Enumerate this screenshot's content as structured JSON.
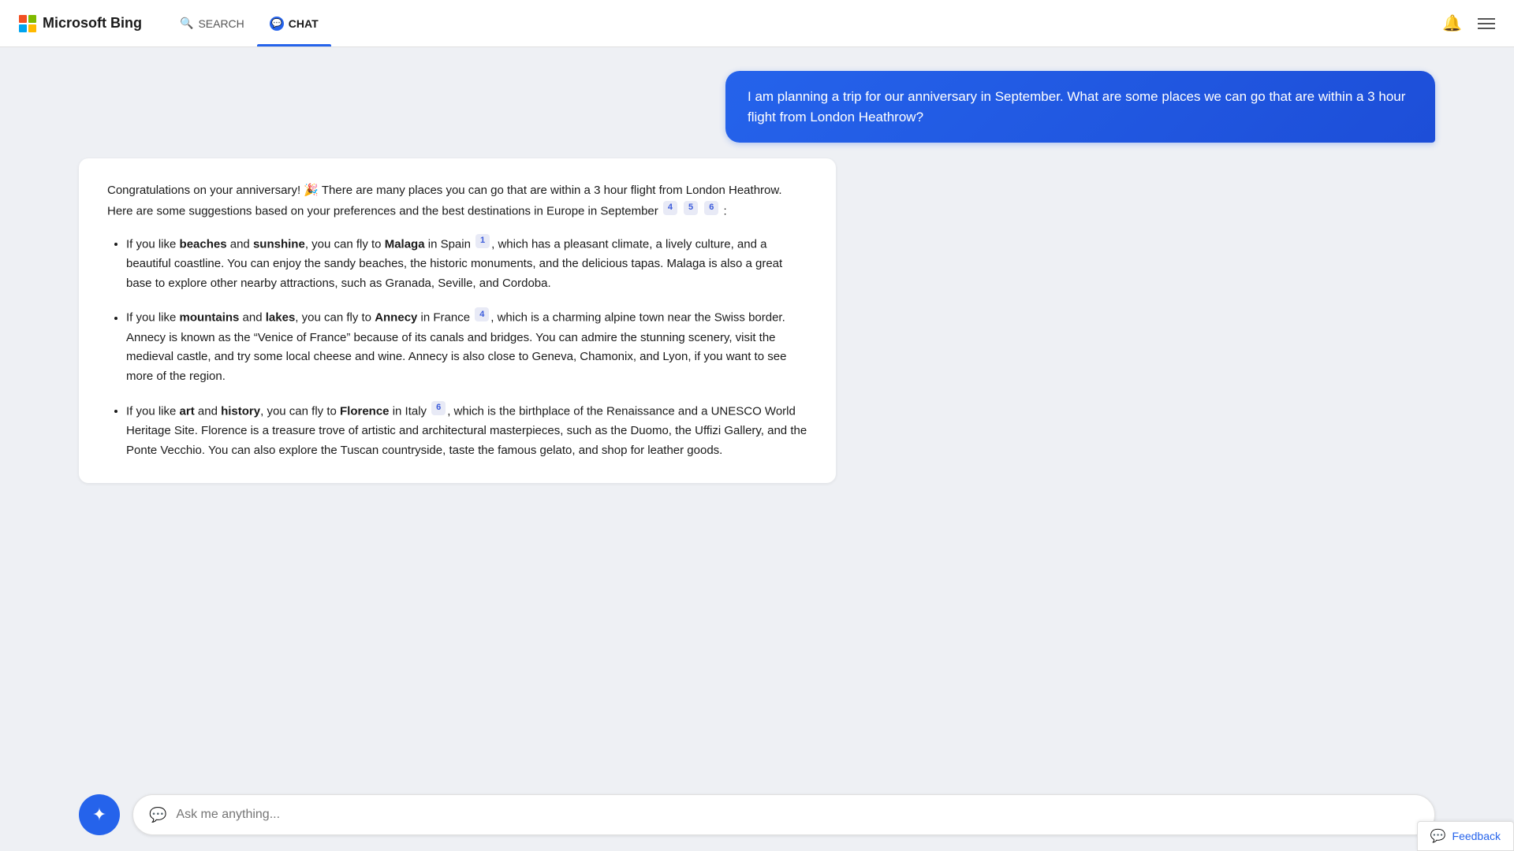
{
  "header": {
    "logo_text": "Microsoft Bing",
    "nav_search": "SEARCH",
    "nav_chat": "CHAT"
  },
  "user_message": "I am planning a trip for our anniversary in September. What are some places we can go that are within a 3 hour flight from London Heathrow?",
  "ai_response": {
    "intro": "Congratulations on your anniversary! 🎉 There are many places you can go that are within a 3 hour flight from London Heathrow. Here are some suggestions based on your preferences and the best destinations in Europe in September",
    "citations_intro": [
      "4",
      "5",
      "6"
    ],
    "items": [
      {
        "text_before": "If you like ",
        "bold1": "beaches",
        "text_mid1": " and ",
        "bold2": "sunshine",
        "text_mid2": ", you can fly to ",
        "bold3": "Malaga",
        "text_mid3": " in Spain",
        "citation": "1",
        "text_after": ", which has a pleasant climate, a lively culture, and a beautiful coastline. You can enjoy the sandy beaches, the historic monuments, and the delicious tapas. Malaga is also a great base to explore other nearby attractions, such as Granada, Seville, and Cordoba."
      },
      {
        "text_before": "If you like ",
        "bold1": "mountains",
        "text_mid1": " and ",
        "bold2": "lakes",
        "text_mid2": ", you can fly to ",
        "bold3": "Annecy",
        "text_mid3": " in France",
        "citation": "4",
        "text_after": ", which is a charming alpine town near the Swiss border. Annecy is known as the “Venice of France” because of its canals and bridges. You can admire the stunning scenery, visit the medieval castle, and try some local cheese and wine. Annecy is also close to Geneva, Chamonix, and Lyon, if you want to see more of the region."
      },
      {
        "text_before": "If you like ",
        "bold1": "art",
        "text_mid1": " and ",
        "bold2": "history",
        "text_mid2": ", you can fly to ",
        "bold3": "Florence",
        "text_mid3": " in Italy",
        "citation": "6",
        "text_after": ", which is the birthplace of the Renaissance and a UNESCO World Heritage Site. Florence is a treasure trove of artistic and architectural masterpieces, such as the Duomo, the Uffizi Gallery, and the Ponte Vecchio. You can also explore the Tuscan countryside, taste the famous gelato, and shop for leather goods."
      }
    ]
  },
  "input": {
    "placeholder": "Ask me anything..."
  },
  "feedback": {
    "label": "Feedback"
  }
}
